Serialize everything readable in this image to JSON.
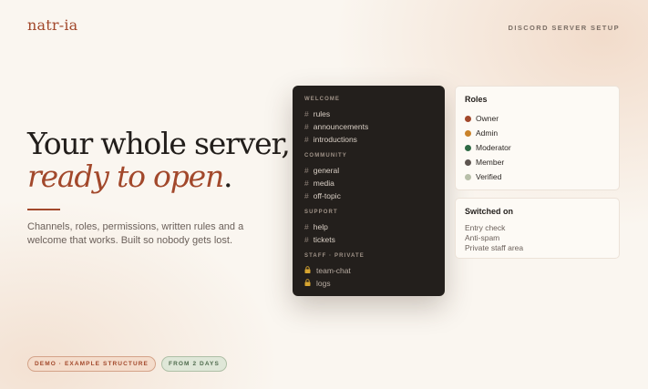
{
  "brand": "natr-ia",
  "eyebrow": "DISCORD SERVER SETUP",
  "headline": {
    "line1": "Your whole server,",
    "accent": "ready to open",
    "period": "."
  },
  "subtitle": "Channels, roles, permissions, written rules and a welcome that works. Built so nobody gets lost.",
  "pills": {
    "demo": "DEMO · EXAMPLE STRUCTURE",
    "days": "FROM 2 DAYS"
  },
  "channel_panel": {
    "hash": "#",
    "categories": [
      {
        "name": "WELCOME",
        "channels": [
          "rules",
          "announcements",
          "introductions"
        ]
      },
      {
        "name": "COMMUNITY",
        "channels": [
          "general",
          "media",
          "off-topic"
        ]
      },
      {
        "name": "SUPPORT",
        "channels": [
          "help",
          "tickets"
        ]
      },
      {
        "name": "STAFF · PRIVATE",
        "channels": [
          "team-chat",
          "logs"
        ],
        "icon": "lock-icon"
      }
    ]
  },
  "roles_card": {
    "title": "Roles",
    "roles": [
      {
        "name": "Owner",
        "color": "#a2482b"
      },
      {
        "name": "Admin",
        "color": "#c9822a"
      },
      {
        "name": "Moderator",
        "color": "#2f6a45"
      },
      {
        "name": "Member",
        "color": "#5e5550"
      },
      {
        "name": "Verified",
        "color": "#b8bfa9"
      }
    ]
  },
  "switched_card": {
    "title": "Switched on",
    "features": [
      "Entry check",
      "Anti-spam",
      "Private staff area"
    ]
  }
}
